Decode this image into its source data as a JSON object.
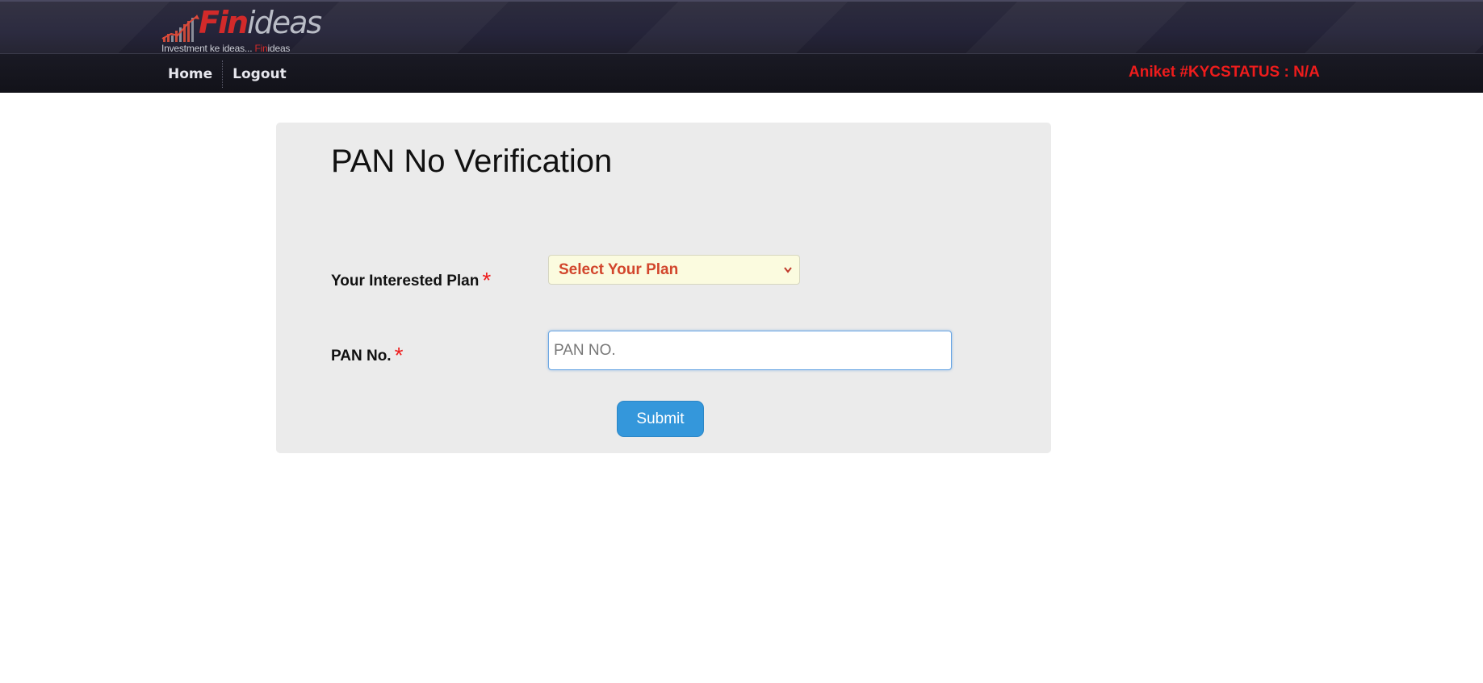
{
  "brand": {
    "name_part1": "Fin",
    "name_part2": "ideas",
    "tagline_part1": "Investment ke ideas... ",
    "tagline_part2": "Fin",
    "tagline_part3": "ideas",
    "accent_color": "#d22a2a"
  },
  "nav": {
    "items": [
      {
        "label": "Home"
      },
      {
        "label": "Logout"
      }
    ],
    "user_status": "Aniket #KYCSTATUS : N/A",
    "user_status_color": "#ee1c1c"
  },
  "form": {
    "title": "PAN No Verification",
    "plan_label": "Your Interested Plan",
    "plan_selected": "Select Your Plan",
    "pan_label": "PAN No.",
    "pan_placeholder": "PAN NO.",
    "pan_value": "",
    "required_marker": "*",
    "submit_label": "Submit",
    "submit_color": "#3497db"
  },
  "icons": {
    "dropdown": "chevron-down-icon",
    "logo_graph": "bar-chart-icon"
  }
}
